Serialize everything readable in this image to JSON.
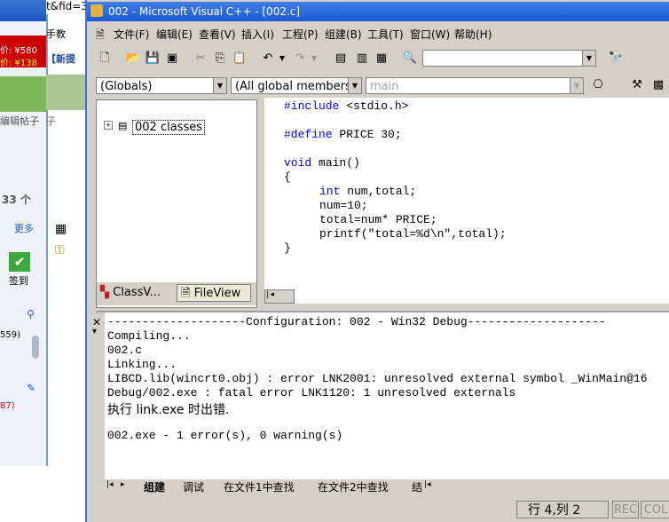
{
  "bg": {
    "url_fragment": "t&fid=3",
    "nav_partial": "手教",
    "price_old": "价: ¥580",
    "price_new": "价: ¥138",
    "bracket_text": "【新提",
    "edit_post": "编辑帖子",
    "count_text": "33 个",
    "more": "更多",
    "checkin": "签到",
    "num_559": "559)",
    "num_87": "87)"
  },
  "vc": {
    "title": "002 - Microsoft Visual C++ - [002.c]",
    "menus": [
      "文件(F)",
      "编辑(E)",
      "查看(V)",
      "插入(I)",
      "工程(P)",
      "组建(B)",
      "工具(T)",
      "窗口(W)",
      "帮助(H)"
    ],
    "combo_globals": "(Globals)",
    "combo_members": "(All global members",
    "combo_main": "main",
    "tree_root": "002 classes",
    "ws_tab_class": "ClassV...",
    "ws_tab_file": "FileView",
    "code_lines": [
      {
        "kw": "#include",
        "rest": " <stdio.h>"
      },
      {
        "kw": "#define",
        "rest": " PRICE 30;"
      },
      {
        "kw": "void",
        "rest": " main()"
      },
      {
        "kw": "",
        "rest": "{"
      },
      {
        "kw": "int",
        "rest": " num,total;"
      },
      {
        "kw": "",
        "rest": "num=10;"
      },
      {
        "kw": "",
        "rest": "total=num* PRICE;"
      },
      {
        "kw": "",
        "rest": "printf(\"total=%d\\n\",total);"
      },
      {
        "kw": "",
        "rest": "}"
      }
    ],
    "output_lines": [
      "--------------------Configuration: 002 - Win32 Debug--------------------",
      "Compiling...",
      "002.c",
      "Linking...",
      "LIBCD.lib(wincrt0.obj) : error LNK2001: unresolved external symbol _WinMain@16",
      "Debug/002.exe : fatal error LNK1120: 1 unresolved externals",
      "执行 link.exe 时出错.",
      "",
      "002.exe - 1 error(s), 0 warning(s)"
    ],
    "out_tabs": [
      "组建",
      "调试",
      "在文件1中查找",
      "在文件2中查找",
      "结"
    ],
    "status_pos": "行 4,列 2",
    "status_rec": "REC",
    "status_col": "COL"
  }
}
